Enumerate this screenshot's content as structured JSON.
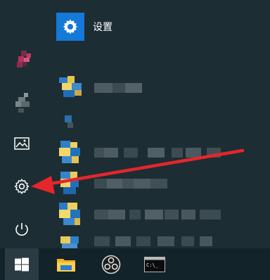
{
  "start_menu": {
    "pinned_app": {
      "label": "设置",
      "icon": "gear-icon"
    },
    "rail": [
      {
        "name": "user-avatar",
        "icon": "pixelated-avatar-icon"
      },
      {
        "name": "documents",
        "icon": "document-icon"
      },
      {
        "name": "pictures",
        "icon": "picture-icon"
      },
      {
        "name": "settings",
        "icon": "gear-icon"
      },
      {
        "name": "power",
        "icon": "power-icon"
      }
    ],
    "app_list": [
      {
        "icon": "blurred-app-icon",
        "label": ""
      },
      {
        "icon": "blurred-app-icon",
        "label": ""
      },
      {
        "icon": "blurred-app-icon",
        "label": ""
      },
      {
        "icon": "blurred-app-icon",
        "label": ""
      },
      {
        "icon": "blurred-app-icon",
        "label": ""
      },
      {
        "icon": "blurred-app-icon",
        "label": ""
      }
    ]
  },
  "taskbar": {
    "items": [
      {
        "name": "start",
        "icon": "windows-logo-icon"
      },
      {
        "name": "file-explorer",
        "icon": "folder-icon"
      },
      {
        "name": "obs",
        "icon": "obs-icon"
      },
      {
        "name": "command-prompt",
        "icon": "cmd-icon",
        "text": "C:\\_"
      }
    ]
  },
  "colors": {
    "background": "#1d2d34",
    "accent": "#1479d8",
    "annotation_arrow": "#e5262b",
    "taskbar": "#13232a"
  }
}
